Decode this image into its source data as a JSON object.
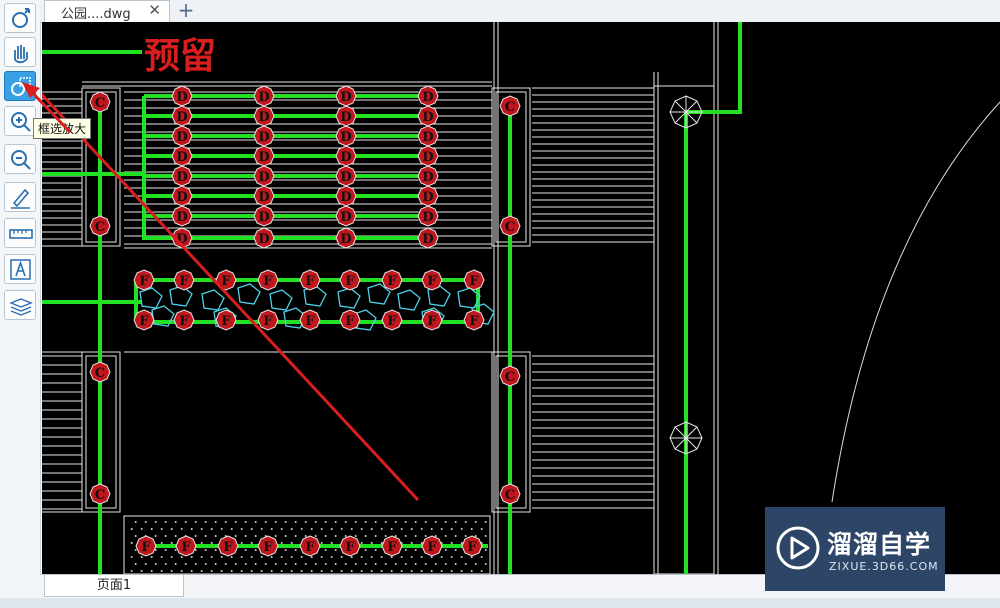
{
  "document_tab": {
    "title": "公园....dwg",
    "close": "✕"
  },
  "add_tab": "+",
  "tooltip": "框选放大",
  "drawing": {
    "annotation_text": "预留",
    "label_c": "C",
    "label_d": "D",
    "label_f": "F"
  },
  "page_tab": "页面1",
  "watermark": {
    "title": "溜溜自学",
    "url": "ZIXUE.3D66.COM"
  },
  "toolbar": {
    "items": [
      "undo-view",
      "pan",
      "window-zoom",
      "zoom-in",
      "zoom-out",
      "markup",
      "measure",
      "text",
      "layers"
    ],
    "active": "window-zoom"
  },
  "colors": {
    "canvas": "#000000",
    "line_green": "#22e022",
    "outline_white": "#e6e6e6",
    "symbol_red": "#c0161c",
    "arrow_red": "#d81e1e",
    "cyan": "#4fd0e6"
  }
}
